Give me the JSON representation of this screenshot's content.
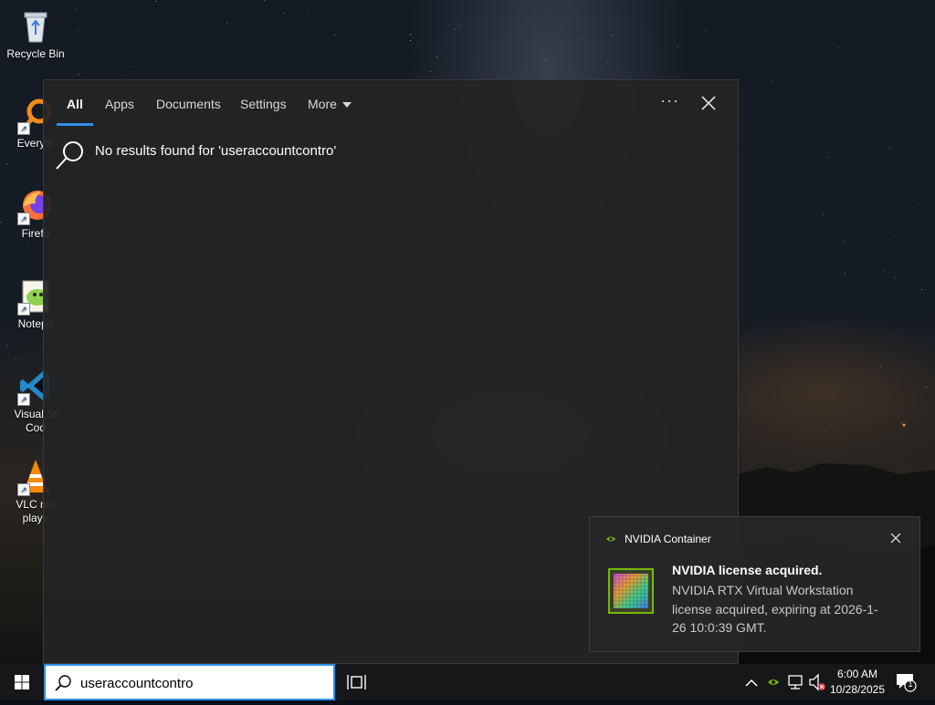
{
  "desktop": {
    "icons": [
      {
        "label": "Recycle Bin",
        "icon": "recycle-bin-icon"
      },
      {
        "label": "Everyth",
        "icon": "everything-search-icon"
      },
      {
        "label": "Firefo",
        "icon": "firefox-icon"
      },
      {
        "label": "Notepa",
        "icon": "notepad-plus-plus-icon"
      },
      {
        "label_line1": "Visual St",
        "label_line2": "Cod",
        "icon": "vscode-icon"
      },
      {
        "label_line1": "VLC me",
        "label_line2": "playe",
        "icon": "vlc-icon"
      }
    ]
  },
  "search_panel": {
    "tabs": [
      {
        "label": "All",
        "active": true
      },
      {
        "label": "Apps"
      },
      {
        "label": "Documents"
      },
      {
        "label": "Settings"
      },
      {
        "label": "More"
      }
    ],
    "options_label": "···",
    "no_results_text": "No results found for 'useraccountcontro'",
    "accent_color": "#2f8fe6"
  },
  "notification": {
    "app_name": "NVIDIA Container",
    "title": "NVIDIA license acquired.",
    "body": "NVIDIA RTX Virtual Workstation license acquired, expiring at 2026-1-26 10:0:39 GMT.",
    "brand_color": "#76b900"
  },
  "taskbar": {
    "search_value": "useraccountcontro",
    "clock_time": "6:00 AM",
    "clock_date": "10/28/2025",
    "notification_count": "1"
  }
}
